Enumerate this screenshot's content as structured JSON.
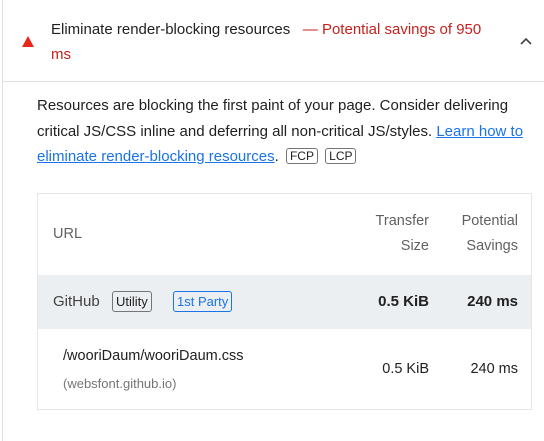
{
  "audit": {
    "title": "Eliminate render-blocking resources",
    "savings": "— Potential savings of 950 ms",
    "status_icon": "fail-triangle-icon",
    "status_color": "#e8261a",
    "expanded_icon": "chevron-up-icon"
  },
  "description": {
    "text": "Resources are blocking the first paint of your page. Consider delivering critical JS/CSS inline and deferring all non-critical JS/styles.",
    "link_label": "Learn how to eliminate render-blocking resources",
    "after_link": ".",
    "metric_chips": [
      "FCP",
      "LCP"
    ]
  },
  "table": {
    "headers": {
      "url": "URL",
      "transfer_size": [
        "Transfer",
        "Size"
      ],
      "potential_savings": [
        "Potential",
        "Savings"
      ]
    },
    "groups": [
      {
        "entity": "GitHub",
        "tags": [
          "Utility",
          "1st Party"
        ],
        "transfer_size": "0.5 KiB",
        "potential_savings": "240 ms",
        "items": [
          {
            "url": "/wooriDaum/wooriDaum.css",
            "host": "(websfont.github.io)",
            "transfer_size": "0.5 KiB",
            "potential_savings": "240 ms"
          }
        ]
      }
    ]
  },
  "colors": {
    "savings_text": "#c5221f",
    "link": "#1a73e8",
    "group_row_bg": "#eceff1"
  }
}
